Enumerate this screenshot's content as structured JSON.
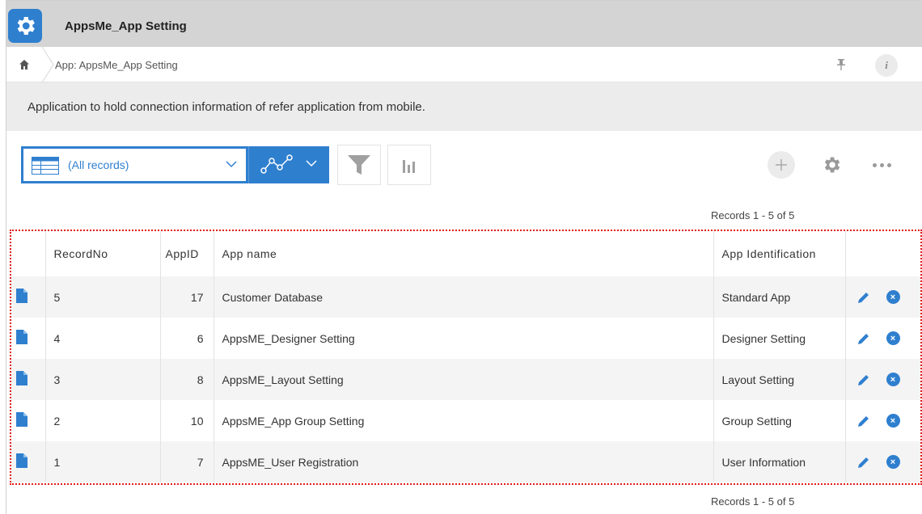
{
  "app": {
    "title": "AppsMe_App Setting",
    "icon": "gear-icon",
    "accent_color": "#2f7fcf"
  },
  "breadcrumb": {
    "home_icon": "home-icon",
    "path": "App: AppsMe_App Setting",
    "pin_icon": "pin-icon",
    "info_label": "i"
  },
  "description": "Application to hold connection information of refer application from mobile.",
  "toolbar": {
    "view_label": "(All records)",
    "view_icon": "table-view-icon",
    "graph_icon": "graph-icon",
    "filter_icon": "filter-icon",
    "chart_icon": "bar-chart-icon",
    "add_icon": "plus-icon",
    "settings_icon": "gear-icon",
    "more_icon": "more-icon"
  },
  "records_count_top": "Records 1 - 5 of 5",
  "records_count_bottom": "Records 1 - 5 of 5",
  "table": {
    "columns": [
      "",
      "RecordNo",
      "AppID",
      "App name",
      "App Identification",
      ""
    ],
    "rows": [
      {
        "record_no": "5",
        "app_id": "17",
        "app_name": "Customer Database",
        "identification": "Standard App"
      },
      {
        "record_no": "4",
        "app_id": "6",
        "app_name": "AppsME_Designer Setting",
        "identification": "Designer Setting"
      },
      {
        "record_no": "3",
        "app_id": "8",
        "app_name": "AppsME_Layout Setting",
        "identification": "Layout Setting"
      },
      {
        "record_no": "2",
        "app_id": "10",
        "app_name": "AppsME_App Group Setting",
        "identification": "Group Setting"
      },
      {
        "record_no": "1",
        "app_id": "7",
        "app_name": "AppsME_User Registration",
        "identification": "User Information"
      }
    ]
  }
}
